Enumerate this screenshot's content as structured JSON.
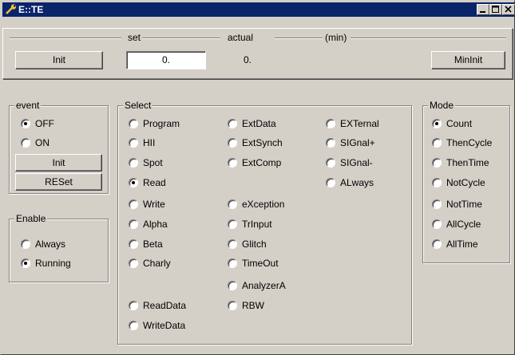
{
  "window": {
    "title": "E::TE"
  },
  "top": {
    "init_label": "Init",
    "set_label": "set",
    "set_value": "0.",
    "actual_label": "actual",
    "actual_value": "0.",
    "min_label": "(min)",
    "mininit_label": "MinInit"
  },
  "event": {
    "title": "event",
    "options": [
      {
        "label": "OFF",
        "checked": true
      },
      {
        "label": "ON",
        "checked": false
      }
    ],
    "init_label": "Init",
    "reset_label": "RESet"
  },
  "enable": {
    "title": "Enable",
    "options": [
      {
        "label": "Always",
        "checked": false
      },
      {
        "label": "Running",
        "checked": true
      }
    ]
  },
  "select": {
    "title": "Select",
    "col1": [
      {
        "label": "Program",
        "checked": false
      },
      {
        "label": "HII",
        "checked": false
      },
      {
        "label": "Spot",
        "checked": false
      },
      {
        "label": "Read",
        "checked": true
      },
      {
        "label": "Write",
        "checked": false
      },
      {
        "label": "Alpha",
        "checked": false
      },
      {
        "label": "Beta",
        "checked": false
      },
      {
        "label": "Charly",
        "checked": false
      },
      {
        "label": "ReadData",
        "checked": false
      },
      {
        "label": "WriteData",
        "checked": false
      }
    ],
    "col2": [
      {
        "label": "ExtData",
        "checked": false
      },
      {
        "label": "ExtSynch",
        "checked": false
      },
      {
        "label": "ExtComp",
        "checked": false
      },
      {
        "label": "eXception",
        "checked": false
      },
      {
        "label": "TrInput",
        "checked": false
      },
      {
        "label": "Glitch",
        "checked": false
      },
      {
        "label": "TimeOut",
        "checked": false
      },
      {
        "label": "AnalyzerA",
        "checked": false
      },
      {
        "label": "RBW",
        "checked": false
      }
    ],
    "col3": [
      {
        "label": "EXTernal",
        "checked": false
      },
      {
        "label": "SIGnal+",
        "checked": false
      },
      {
        "label": "SIGnal-",
        "checked": false
      },
      {
        "label": "ALways",
        "checked": false
      }
    ]
  },
  "mode": {
    "title": "Mode",
    "options": [
      {
        "label": "Count",
        "checked": true
      },
      {
        "label": "ThenCycle",
        "checked": false
      },
      {
        "label": "ThenTime",
        "checked": false
      },
      {
        "label": "NotCycle",
        "checked": false
      },
      {
        "label": "NotTime",
        "checked": false
      },
      {
        "label": "AllCycle",
        "checked": false
      },
      {
        "label": "AllTime",
        "checked": false
      }
    ]
  }
}
